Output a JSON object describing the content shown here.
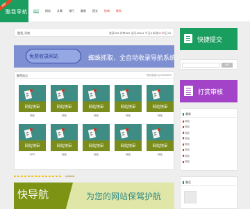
{
  "logo": {
    "text": "酷我导航",
    "ribbon": "推荐"
  },
  "nav": [
    {
      "label": "首页",
      "state": "active"
    },
    {
      "label": "网站",
      "state": "normal"
    },
    {
      "label": "文章",
      "state": "normal"
    },
    {
      "label": "排行",
      "state": "normal"
    },
    {
      "label": "最新",
      "state": "normal"
    },
    {
      "label": "提交",
      "state": "normal"
    },
    {
      "label": "快审",
      "state": "hot"
    },
    {
      "label": "联系",
      "state": "hot"
    }
  ],
  "stats": {
    "site_name": "酷我_导航",
    "prefix": "收录",
    "total": "205",
    "pending_label": "待审",
    "pending": "362",
    "visits_label": "访问",
    "visits": "42544",
    "today_label": "今日",
    "today": "8",
    "new_label": "新增",
    "new": "10",
    "yest_label": "昨日",
    "yest": "34"
  },
  "banner1": {
    "pill": "免费收录网站",
    "slogan": "蜘蛛抓取，全自动收录导航系统"
  },
  "grid": {
    "title": "推荐站点",
    "meta": "联系客服QQ:28698896",
    "tiles": [
      {
        "label": "网站快审",
        "caption": "网站"
      },
      {
        "label": "网站快审",
        "caption": "网站"
      },
      {
        "label": "网站快审",
        "caption": "网站"
      },
      {
        "label": "网站快审",
        "caption": "网站"
      },
      {
        "label": "网站快审",
        "caption": "网站"
      },
      {
        "label": "网站快审",
        "caption": "VPS!"
      },
      {
        "label": "网站快审",
        "caption": "网站"
      },
      {
        "label": "网站快审",
        "caption": "网站"
      },
      {
        "label": "网站快审",
        "caption": "网站"
      },
      {
        "label": "网站快审",
        "caption": "网站"
      }
    ]
  },
  "bottom_bar": {
    "text": "28698896"
  },
  "banner2": {
    "big": "快导航",
    "tagline": "为您的网站保驾护航"
  },
  "sidebar": {
    "submit_button": "快捷提交",
    "search_placeholder": "",
    "search_button": "搜索",
    "tip_button": "打赏审核",
    "latest_title": "最新",
    "latest_items": [
      "网站",
      "网站",
      "网站",
      "网站",
      "网站",
      "网站",
      "网站",
      "网站"
    ],
    "recent_title": "最近"
  },
  "colors": {
    "brand_green": "#1a9e5f",
    "purple": "#a344c8",
    "banner_blue": "#7e8fd2",
    "hot_red": "#e0372c"
  }
}
